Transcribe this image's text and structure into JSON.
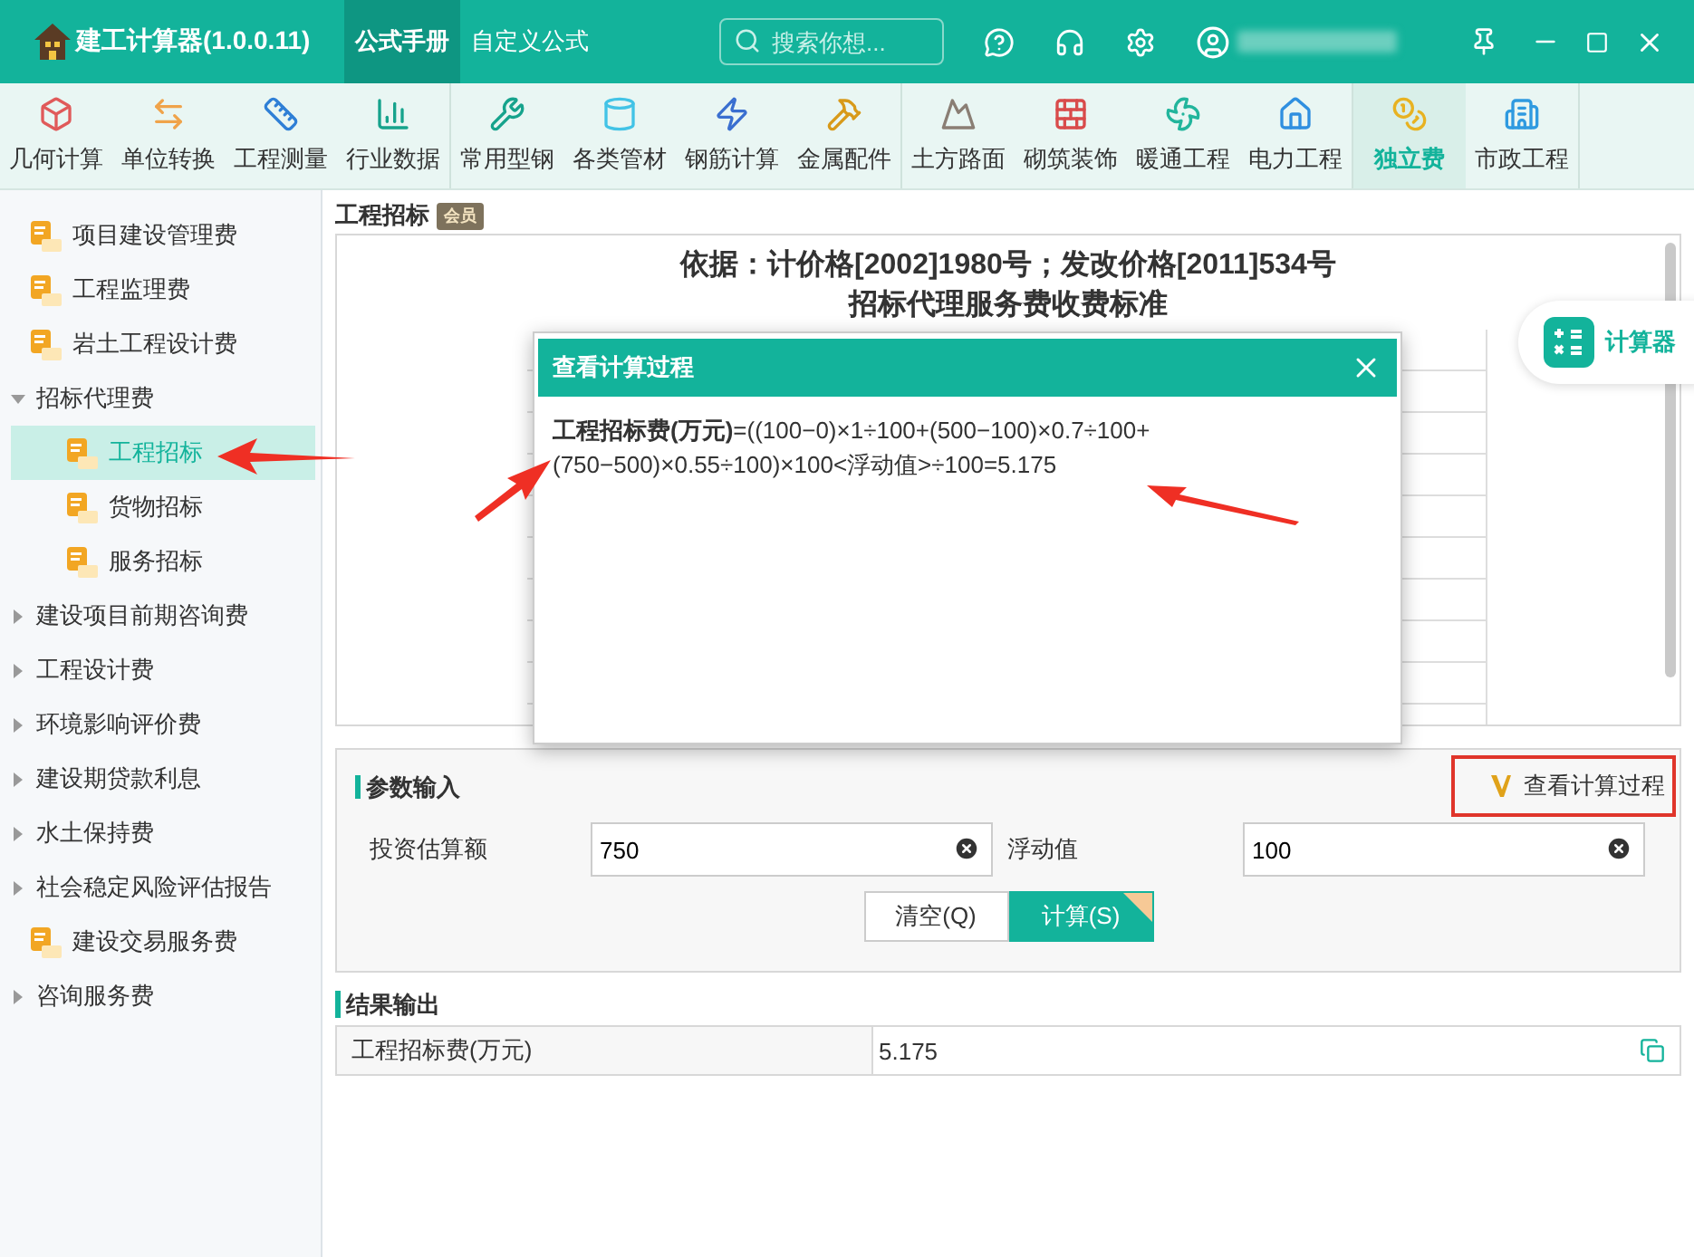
{
  "app": {
    "title": "建工计算器(1.0.0.11)"
  },
  "top_tabs": [
    {
      "label": "公式手册",
      "selected": true
    },
    {
      "label": "自定义公式",
      "selected": false
    }
  ],
  "search": {
    "placeholder": "搜索你想..."
  },
  "toolbar_groups": [
    {
      "items": [
        {
          "label": "几何计算",
          "selected": false
        },
        {
          "label": "单位转换",
          "selected": false
        },
        {
          "label": "工程测量",
          "selected": false
        },
        {
          "label": "行业数据",
          "selected": false
        }
      ]
    },
    {
      "items": [
        {
          "label": "常用型钢",
          "selected": false
        },
        {
          "label": "各类管材",
          "selected": false
        },
        {
          "label": "钢筋计算",
          "selected": false
        },
        {
          "label": "金属配件",
          "selected": false
        }
      ]
    },
    {
      "items": [
        {
          "label": "土方路面",
          "selected": false
        },
        {
          "label": "砌筑装饰",
          "selected": false
        },
        {
          "label": "暖通工程",
          "selected": false
        },
        {
          "label": "电力工程",
          "selected": false
        }
      ]
    },
    {
      "items": [
        {
          "label": "独立费",
          "selected": true
        },
        {
          "label": "市政工程",
          "selected": false
        }
      ]
    }
  ],
  "sidebar": [
    {
      "kind": "leaf",
      "label": "项目建设管理费",
      "selected": false
    },
    {
      "kind": "leaf",
      "label": "工程监理费",
      "selected": false
    },
    {
      "kind": "leaf",
      "label": "岩土工程设计费",
      "selected": false
    },
    {
      "kind": "group",
      "label": "招标代理费",
      "expanded": true,
      "children": [
        {
          "kind": "leaf",
          "label": "工程招标",
          "selected": true
        },
        {
          "kind": "leaf",
          "label": "货物招标",
          "selected": false
        },
        {
          "kind": "leaf",
          "label": "服务招标",
          "selected": false
        }
      ]
    },
    {
      "kind": "group",
      "label": "建设项目前期咨询费",
      "expanded": false
    },
    {
      "kind": "group",
      "label": "工程设计费",
      "expanded": false
    },
    {
      "kind": "group",
      "label": "环境影响评价费",
      "expanded": false
    },
    {
      "kind": "group",
      "label": "建设期贷款利息",
      "expanded": false
    },
    {
      "kind": "group",
      "label": "水土保持费",
      "expanded": false
    },
    {
      "kind": "group",
      "label": "社会稳定风险评估报告",
      "expanded": false
    },
    {
      "kind": "leaf",
      "label": "建设交易服务费",
      "selected": false
    },
    {
      "kind": "group",
      "label": "咨询服务费",
      "expanded": false
    }
  ],
  "content": {
    "title": "工程招标",
    "badge": "会员",
    "heading": [
      "依据：计价格[2002]1980号；发改价格[2011]534号",
      "招标代理服务费收费标准"
    ]
  },
  "calculator_button": {
    "label": "计算器"
  },
  "dialog": {
    "title": "查看计算过程",
    "formula": "**工程招标费(万元)**=((100−0)×1÷100+(500−100)×0.7÷100+(750−500)×0.55÷100)×100<浮动值>÷100=5.175"
  },
  "params": {
    "title": "参数输入",
    "process_button": "查看计算过程",
    "fields": [
      {
        "label": "投资估算额",
        "value": "750"
      },
      {
        "label": "浮动值",
        "value": "100"
      }
    ],
    "buttons": [
      {
        "label": "清空(Q)",
        "selected": false
      },
      {
        "label": "计算(S)",
        "selected": true
      }
    ]
  },
  "results": {
    "title": "结果输出",
    "rows": [
      {
        "label": "工程招标费(万元)",
        "value": "5.175"
      }
    ]
  }
}
